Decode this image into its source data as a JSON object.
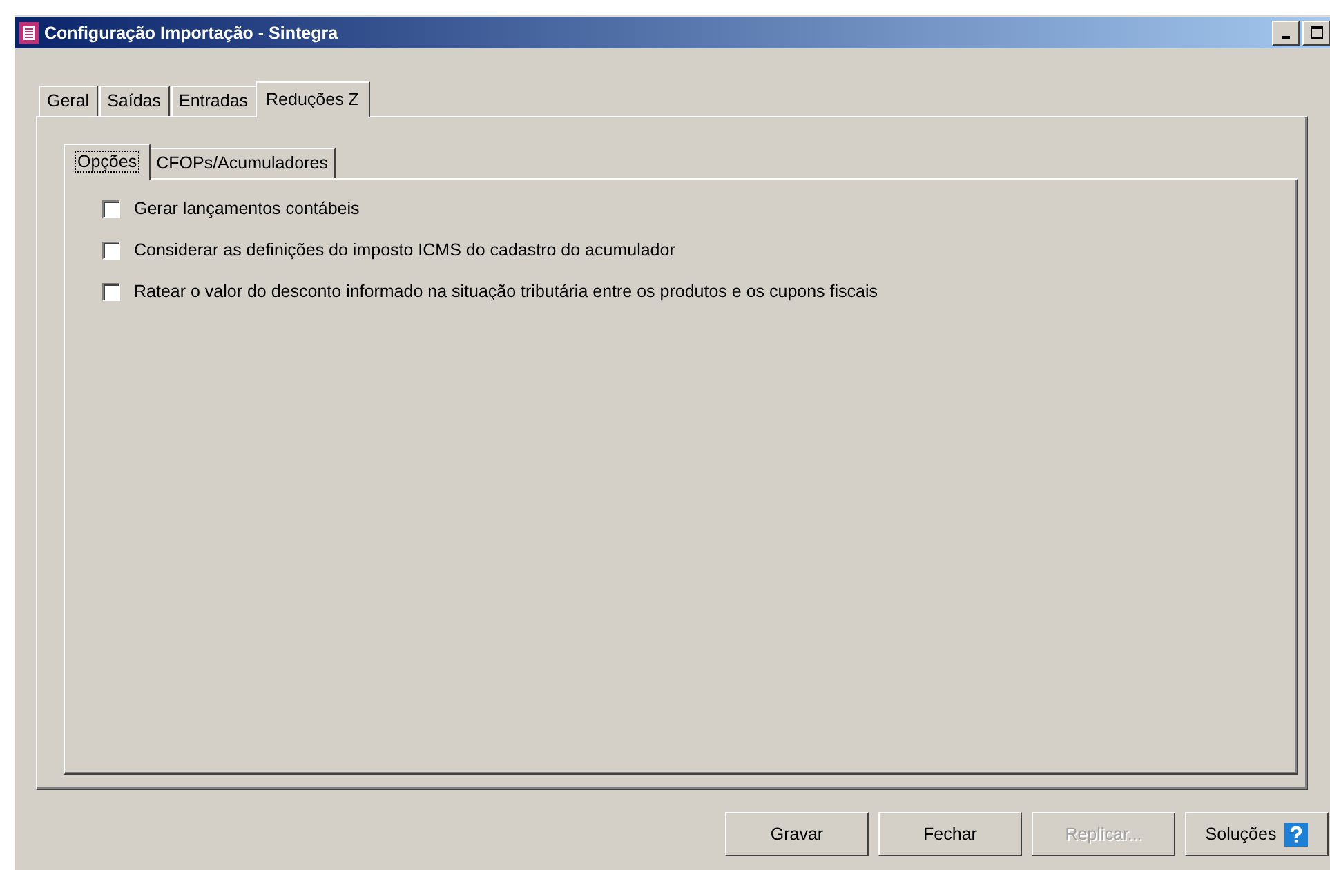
{
  "window": {
    "title": "Configuração Importação - Sintegra"
  },
  "tabs": [
    {
      "label": "Geral",
      "selected": false
    },
    {
      "label": "Saídas",
      "selected": false
    },
    {
      "label": "Entradas",
      "selected": false
    },
    {
      "label": "Reduções Z",
      "selected": true
    }
  ],
  "subtabs": [
    {
      "label": "Opções",
      "selected": true
    },
    {
      "label": "CFOPs/Acumuladores",
      "selected": false
    }
  ],
  "options": [
    {
      "label": "Gerar lançamentos contábeis",
      "checked": false
    },
    {
      "label": "Considerar as definições do imposto ICMS do cadastro do acumulador",
      "checked": false
    },
    {
      "label": "Ratear o valor do desconto informado na situação tributária entre os produtos e os cupons fiscais",
      "checked": false
    }
  ],
  "buttons": [
    {
      "label": "Gravar",
      "disabled": false,
      "kind": "plain"
    },
    {
      "label": "Fechar",
      "disabled": false,
      "kind": "plain"
    },
    {
      "label": "Replicar...",
      "disabled": true,
      "kind": "plain"
    },
    {
      "label": "Soluções",
      "disabled": false,
      "kind": "help"
    }
  ]
}
